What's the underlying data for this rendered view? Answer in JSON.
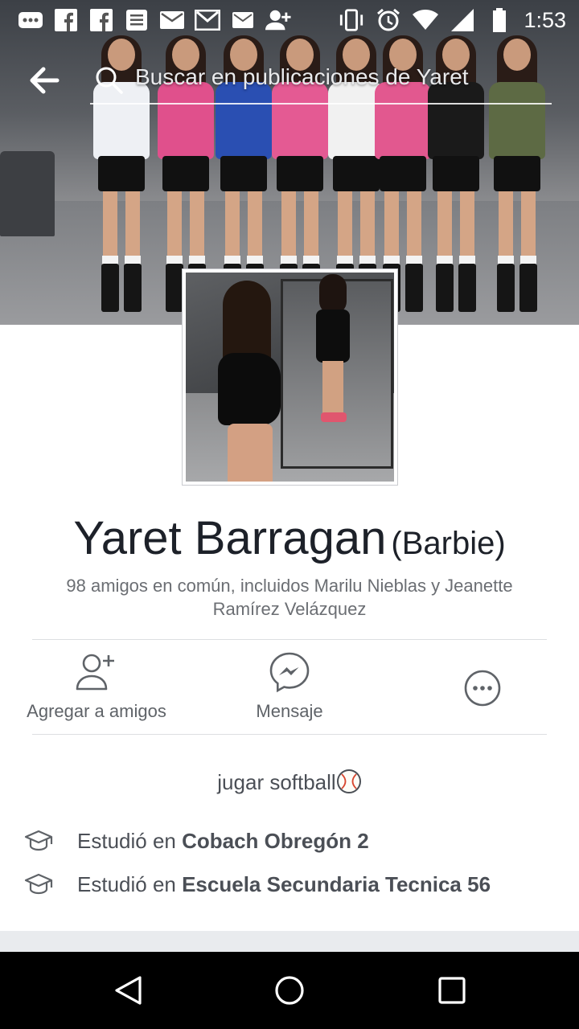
{
  "status_bar": {
    "time": "1:53",
    "left_icons": [
      "more-notifications-icon",
      "facebook-icon",
      "facebook-icon",
      "news-icon",
      "mail-icon",
      "gmail-icon",
      "email-icon",
      "add-person-icon"
    ],
    "right_icons": [
      "vibrate-icon",
      "alarm-icon",
      "wifi-icon",
      "signal-icon",
      "battery-icon"
    ]
  },
  "search": {
    "placeholder": "Buscar en publicaciones de Yaret"
  },
  "profile": {
    "name": "Yaret Barragan",
    "alternate_name": "(Barbie)",
    "mutual_friends": "98 amigos en común, incluidos Marilu Nieblas y Jeanette Ramírez Velázquez"
  },
  "actions": {
    "add_friend": "Agregar a amigos",
    "message": "Mensaje",
    "more_icon": "more-icon"
  },
  "intro": {
    "bio_text": "jugar softball",
    "bio_emoji": "softball-icon",
    "education": [
      {
        "prefix": "Estudió en ",
        "school": "Cobach Obregón 2"
      },
      {
        "prefix": "Estudió en ",
        "school": "Escuela Secundaria Tecnica 56"
      }
    ]
  },
  "colors": {
    "text_dark": "#1d2129",
    "text_secondary": "#4b4f56",
    "text_muted": "#6b6e73",
    "divider": "#dddfe2",
    "nav_background": "#000000"
  }
}
